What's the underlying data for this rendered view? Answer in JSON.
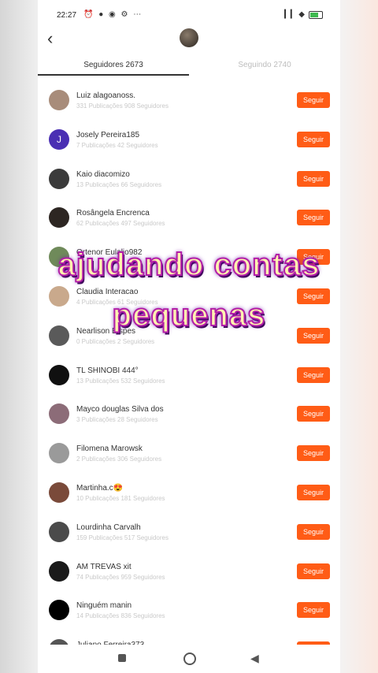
{
  "status_bar": {
    "time": "22:27",
    "left_icons": "⏰ ● ◉ ⚙ ⋯",
    "right_icons": "▎▎ ◆"
  },
  "header": {
    "back_icon": "‹"
  },
  "tabs": [
    {
      "label": "Seguidores 2673",
      "active": true
    },
    {
      "label": "Seguindo 2740",
      "active": false
    }
  ],
  "followers": [
    {
      "name": "Luiz alagoanoss.",
      "stats": "331 Publicações   908 Seguidores",
      "button": "Seguir",
      "avatar_color": "#a88c7a",
      "initial": ""
    },
    {
      "name": "Josely Pereira185",
      "stats": "7 Publicações   42 Seguidores",
      "button": "Seguir",
      "avatar_color": "#4a2fb3",
      "initial": "J"
    },
    {
      "name": "Kaio diacomizo",
      "stats": "13 Publicações   66 Seguidores",
      "button": "Seguir",
      "avatar_color": "#3b3b3b",
      "initial": ""
    },
    {
      "name": "Rosângela Encrenca",
      "stats": "62 Publicações   497 Seguidores",
      "button": "Seguir",
      "avatar_color": "#2d2622",
      "initial": ""
    },
    {
      "name": "Ortenor Eulalio982",
      "stats": "",
      "button": "Seguir",
      "avatar_color": "#6f8a5a",
      "initial": ""
    },
    {
      "name": "Claudia Interacao",
      "stats": "4 Publicações   61 Seguidores",
      "button": "Seguir",
      "avatar_color": "#c9a98c",
      "initial": ""
    },
    {
      "name": "Nearlison Bispes",
      "stats": "0 Publicações   2 Seguidores",
      "button": "Seguir",
      "avatar_color": "#5a5a5a",
      "initial": ""
    },
    {
      "name": "TL SHINOBI 444°",
      "stats": "13 Publicações   532 Seguidores",
      "button": "Seguir",
      "avatar_color": "#101010",
      "initial": ""
    },
    {
      "name": "Mayco douglas Silva dos",
      "stats": "3 Publicações   28 Seguidores",
      "button": "Seguir",
      "avatar_color": "#8c6c78",
      "initial": ""
    },
    {
      "name": "Filomena Marowsk",
      "stats": "2 Publicações   306 Seguidores",
      "button": "Seguir",
      "avatar_color": "#9a9a9a",
      "initial": ""
    },
    {
      "name": "Martinha.c😍",
      "stats": "10 Publicações   181 Seguidores",
      "button": "Seguir",
      "avatar_color": "#7a4a3a",
      "initial": ""
    },
    {
      "name": "Lourdinha Carvalh",
      "stats": "159 Publicações   517 Seguidores",
      "button": "Seguir",
      "avatar_color": "#4b4b4b",
      "initial": ""
    },
    {
      "name": "AM TREVAS xit",
      "stats": "74 Publicações   959 Seguidores",
      "button": "Seguir",
      "avatar_color": "#1a1a1a",
      "initial": ""
    },
    {
      "name": "Ninguém manin",
      "stats": "14 Publicações   836 Seguidores",
      "button": "Seguir",
      "avatar_color": "#000000",
      "initial": ""
    },
    {
      "name": "Juliano Ferreira373",
      "stats": "",
      "button": "Seguir",
      "avatar_color": "#555555",
      "initial": ""
    }
  ],
  "overlay": {
    "line1": "ajudando contas",
    "line2": "pequenas"
  },
  "colors": {
    "accent": "#ff5c16",
    "overlay_fill": "#fff3b0",
    "overlay_stroke": "#b21ea8"
  }
}
